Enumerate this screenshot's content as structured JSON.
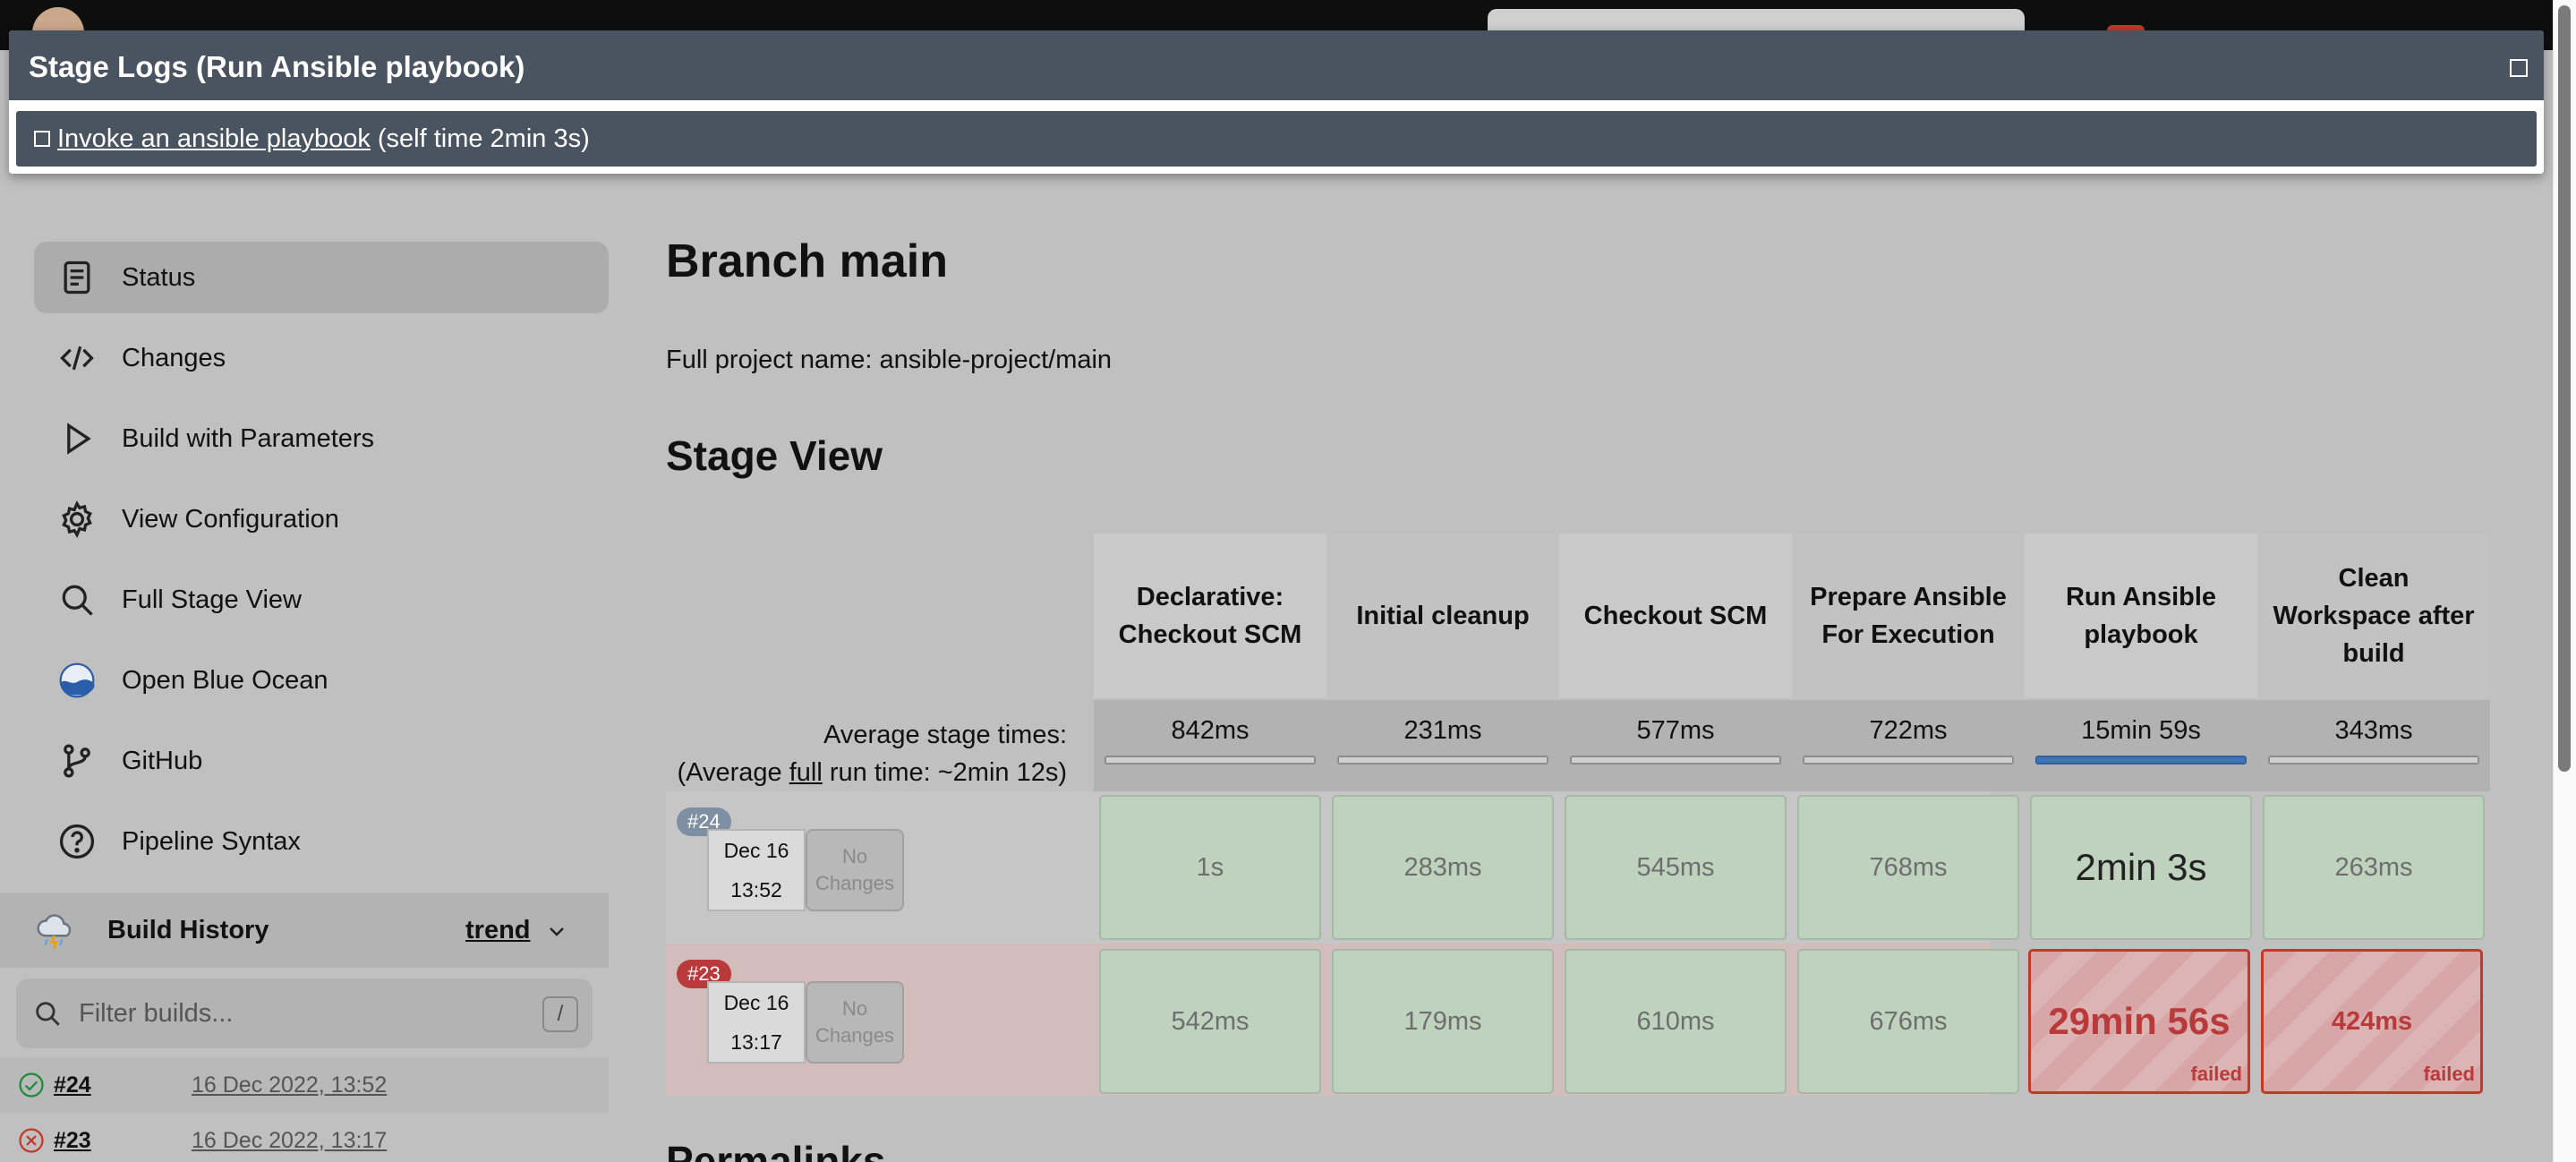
{
  "modal": {
    "title": "Stage Logs (Run Ansible playbook)",
    "log_link": "Invoke an ansible playbook ",
    "log_self_time": "(self time 2min 3s)"
  },
  "sidebar": {
    "items": [
      {
        "label": "Status",
        "icon": "document-icon"
      },
      {
        "label": "Changes",
        "icon": "code-icon"
      },
      {
        "label": "Build with Parameters",
        "icon": "play-icon"
      },
      {
        "label": "View Configuration",
        "icon": "gear-icon"
      },
      {
        "label": "Full Stage View",
        "icon": "search-icon"
      },
      {
        "label": "Open Blue Ocean",
        "icon": "blue-ocean-icon"
      },
      {
        "label": "GitHub",
        "icon": "git-branch-icon"
      },
      {
        "label": "Pipeline Syntax",
        "icon": "help-icon"
      }
    ]
  },
  "build_history": {
    "title": "Build History",
    "trend": "trend",
    "filter_placeholder": "Filter builds...",
    "filter_shortcut": "/",
    "builds": [
      {
        "number": "#24",
        "date": "16 Dec 2022, 13:52",
        "status": "success"
      },
      {
        "number": "#23",
        "date": "16 Dec 2022, 13:17",
        "status": "failed"
      }
    ]
  },
  "main": {
    "title": "Branch main",
    "full_name": "Full project name: ansible-project/main",
    "stage_view_title": "Stage View",
    "permalinks_title": "Permalinks"
  },
  "stage_view": {
    "avg_label": "Average stage times:",
    "avg_full_prefix": "(Average ",
    "avg_full_word": "full",
    "avg_full_suffix": " run time: ~2min 12s)",
    "stages": [
      {
        "name": "Declarative: Checkout SCM",
        "avg": "842ms"
      },
      {
        "name": "Initial cleanup",
        "avg": "231ms"
      },
      {
        "name": "Checkout SCM",
        "avg": "577ms"
      },
      {
        "name": "Prepare Ansible For Execution",
        "avg": "722ms"
      },
      {
        "name": "Run Ansible playbook",
        "avg": "15min 59s"
      },
      {
        "name": "Clean Workspace after build",
        "avg": "343ms"
      }
    ],
    "runs": [
      {
        "badge": "#24",
        "date": "Dec 16",
        "time": "13:52",
        "changes": "No Changes",
        "cells": [
          "1s",
          "283ms",
          "545ms",
          "768ms",
          "2min 3s",
          "263ms"
        ]
      },
      {
        "badge": "#23",
        "date": "Dec 16",
        "time": "13:17",
        "changes": "No Changes",
        "cells": [
          "542ms",
          "179ms",
          "610ms",
          "676ms",
          "29min 56s",
          "424ms"
        ],
        "failed_label": "failed"
      }
    ]
  }
}
